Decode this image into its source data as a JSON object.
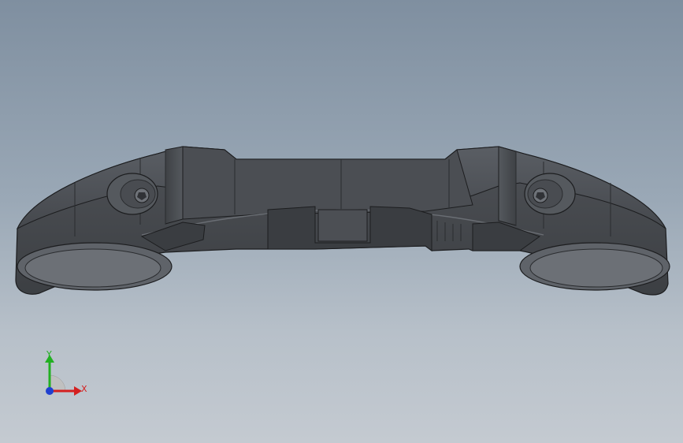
{
  "viewport": {
    "background_top": "#7f8fa0",
    "background_bottom": "#c4cad1"
  },
  "model": {
    "body_color": "#4a4d52",
    "edge_color": "#1c1d1f",
    "highlight_color": "#6a6e74"
  },
  "triad": {
    "x_label": "X",
    "y_label": "Y",
    "x_color": "#d42020",
    "y_color": "#22b022",
    "z_color": "#2040d0"
  }
}
